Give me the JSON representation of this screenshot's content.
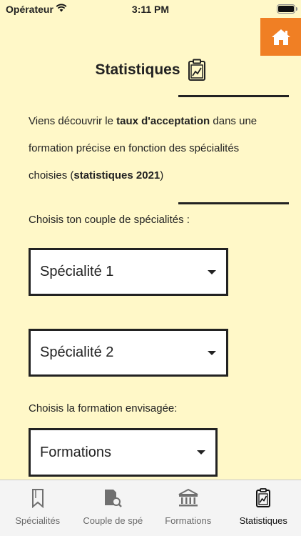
{
  "status_bar": {
    "carrier": "Opérateur",
    "time": "3:11 PM"
  },
  "header": {
    "title": "Statistiques"
  },
  "intro": {
    "part1": "Viens découvrir le ",
    "bold1": "taux d'acceptation",
    "part2": " dans une formation précise en fonction des spécialités choisies (",
    "bold2": "statistiques 2021",
    "part3": ")"
  },
  "form": {
    "couple_prompt": "Choisis ton couple de spécialités :",
    "specialite1": "Spécialité 1",
    "specialite2": "Spécialité 2",
    "formation_prompt": "Choisis la formation envisagée:",
    "formations": "Formations"
  },
  "tabs": [
    {
      "label": "Spécialités",
      "icon": "bookmark-icon"
    },
    {
      "label": "Couple de spé",
      "icon": "document-search-icon"
    },
    {
      "label": "Formations",
      "icon": "bank-icon"
    },
    {
      "label": "Statistiques",
      "icon": "clipboard-chart-icon",
      "active": true
    }
  ],
  "colors": {
    "background": "#fff8c8",
    "accent": "#f07f24",
    "text": "#222222"
  }
}
